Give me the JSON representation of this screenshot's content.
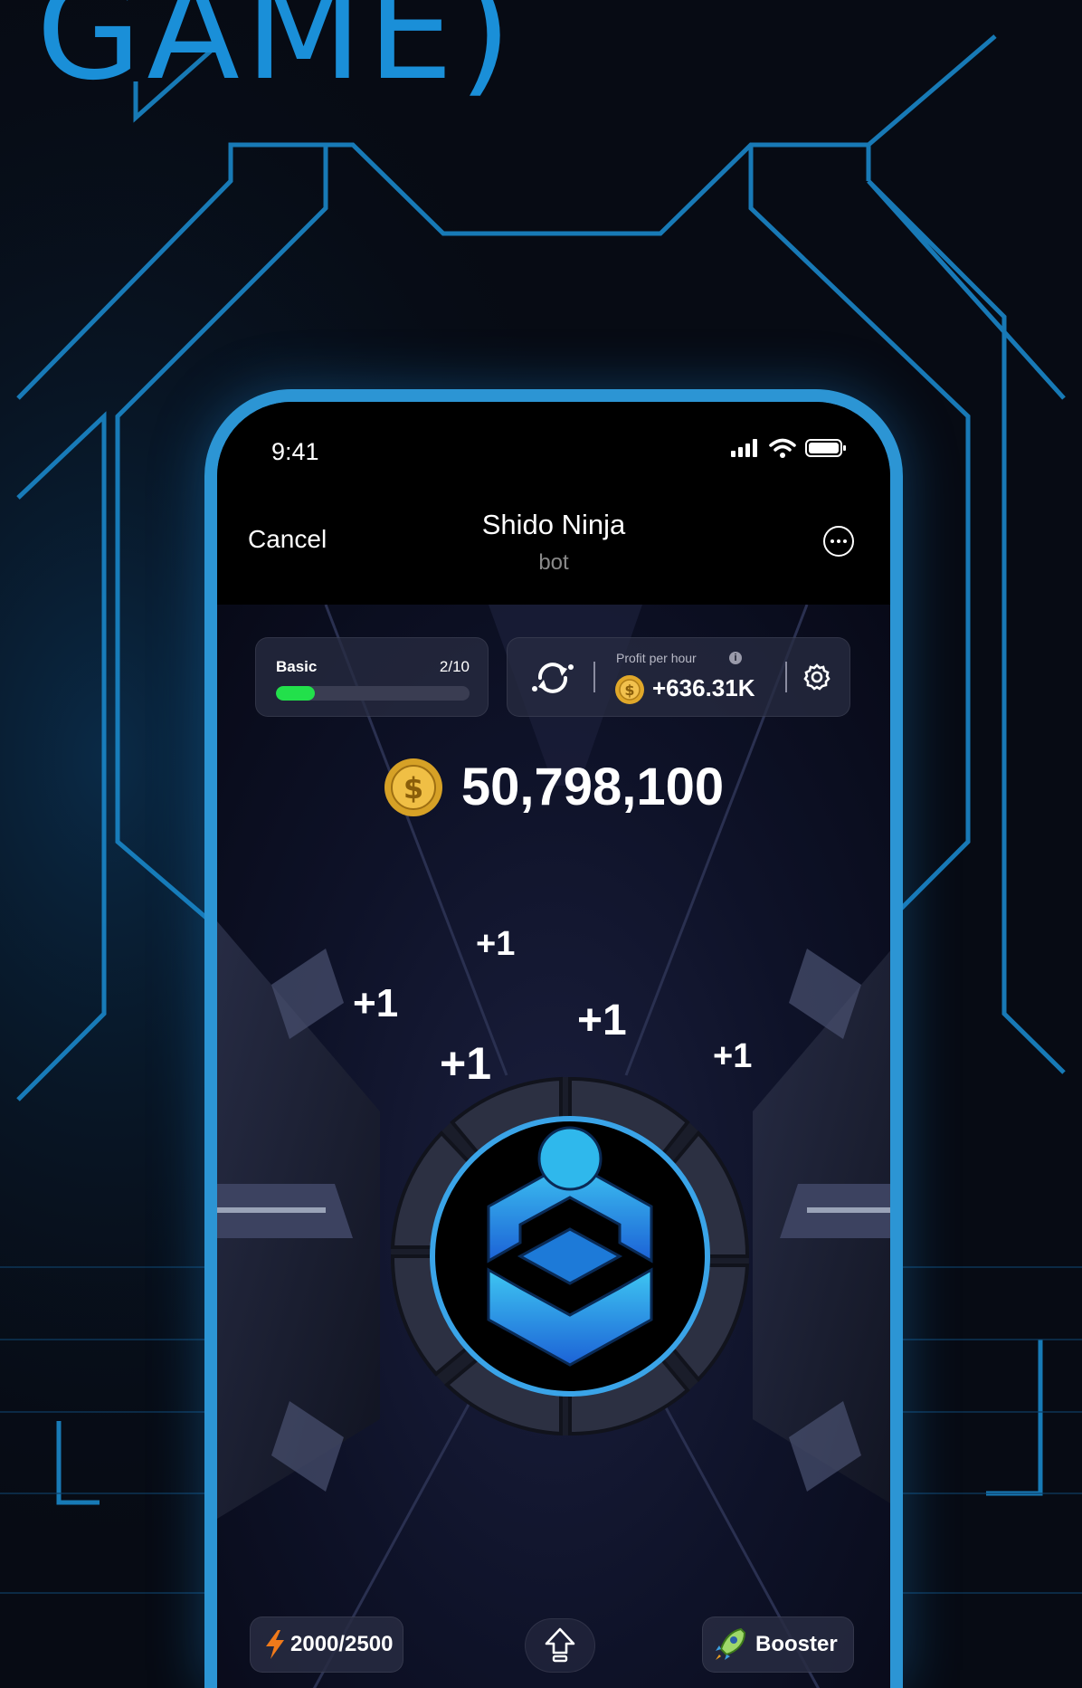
{
  "headline": "GAME)",
  "status_bar": {
    "time": "9:41"
  },
  "nav": {
    "cancel": "Cancel",
    "title": "Shido Ninja",
    "subtitle": "bot"
  },
  "level": {
    "name": "Basic",
    "count": "2/10",
    "progress": 0.2
  },
  "profit": {
    "label": "Profit per hour",
    "info": "i",
    "value": "+636.31K",
    "coin_symbol": "$"
  },
  "balance": {
    "value": "50,798,100",
    "coin_symbol": "$"
  },
  "tap_feedback": [
    "+1",
    "+1",
    "+1",
    "+1",
    "+1"
  ],
  "bottom": {
    "energy": "2000/2500",
    "booster": "Booster"
  },
  "colors": {
    "accent": "#2c95d4",
    "progress": "#22e04b",
    "coin": "#e0a82a",
    "logo": "#3aa4e8"
  },
  "icons": [
    "sync-icon",
    "gear-icon",
    "ellipsis-icon",
    "lightning-icon",
    "home-arrow-icon",
    "rocket-icon",
    "coin-icon",
    "shido-logo-icon"
  ]
}
